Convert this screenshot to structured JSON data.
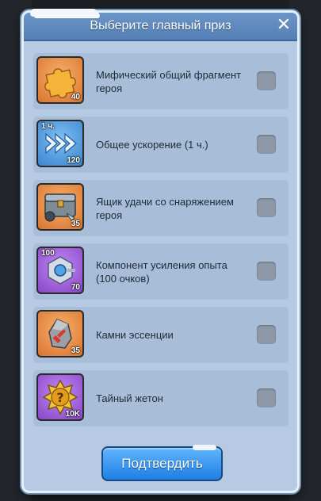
{
  "dialog": {
    "title": "Выберите главный приз",
    "close_glyph": "✕",
    "confirm_label": "Подтвердить"
  },
  "items": [
    {
      "label": "Мифический общий фрагмент героя",
      "qty": "40",
      "top_label": "",
      "icon": "puzzle-piece-icon",
      "color": "orange",
      "checked": false
    },
    {
      "label": "Общее ускорение (1 ч.)",
      "qty": "120",
      "top_label": "1 ч.",
      "icon": "speedup-chevrons-icon",
      "color": "blue",
      "checked": false
    },
    {
      "label": "Ящик удачи со снаряжением героя",
      "qty": "35",
      "top_label": "",
      "icon": "gear-chest-icon",
      "color": "orange",
      "checked": false
    },
    {
      "label": "Компонент усиления опыта (100 очков)",
      "qty": "70",
      "top_label": "100",
      "icon": "exp-component-icon",
      "color": "purple",
      "checked": false
    },
    {
      "label": "Камни эссенции",
      "qty": "35",
      "top_label": "",
      "icon": "essence-stone-icon",
      "color": "orange",
      "checked": false
    },
    {
      "label": "Тайный жетон",
      "qty": "10K",
      "top_label": "",
      "icon": "mystery-token-icon",
      "color": "purple",
      "checked": false
    }
  ],
  "colors": {
    "panel": "#b6cbe3",
    "header": "#5f8abe",
    "row": "#a8bed8",
    "checkbox": "#8e98a6",
    "confirm": "#3b99f2"
  }
}
